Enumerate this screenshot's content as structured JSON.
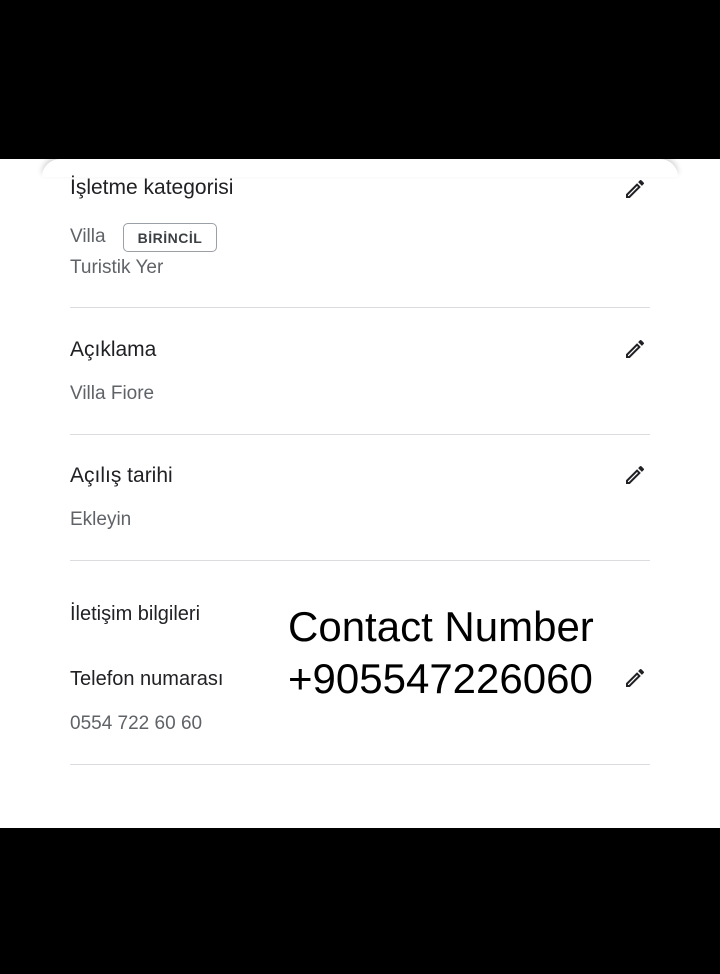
{
  "sections": {
    "category": {
      "title": "İşletme kategorisi",
      "primary_value": "Villa",
      "badge": "BİRİNCİL",
      "secondary_value": "Turistik Yer"
    },
    "description": {
      "title": "Açıklama",
      "value": "Villa Fiore"
    },
    "opening_date": {
      "title": "Açılış tarihi",
      "value": "Ekleyin"
    },
    "contact": {
      "title": "İletişim bilgileri",
      "phone_label": "Telefon numarası",
      "phone_value": "0554 722 60 60"
    }
  },
  "overlay": {
    "line1": "Contact Number",
    "line2": "+905547226060"
  },
  "icons": {
    "edit": "pencil-icon"
  },
  "colors": {
    "background_bars": "#000000",
    "panel": "#ffffff",
    "title_text": "#202124",
    "secondary_text": "#5f6368",
    "divider": "#dadce0"
  }
}
